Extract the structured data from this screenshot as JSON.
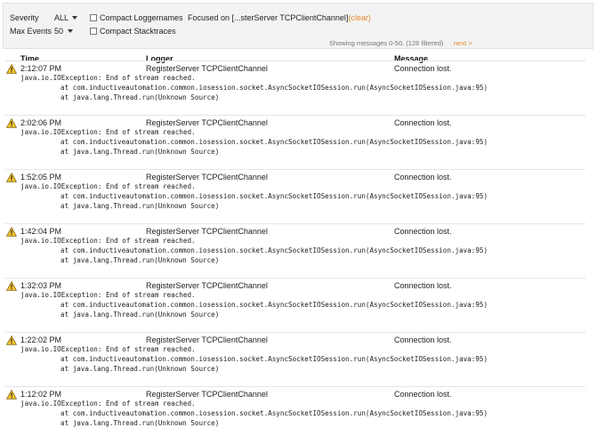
{
  "controls": {
    "severity_label": "Severity",
    "severity_value": "ALL",
    "max_events_label": "Max Events",
    "max_events_value": "50",
    "compact_loggernames_label": "Compact Loggernames",
    "compact_stacktraces_label": "Compact Stacktraces",
    "focused_text": "Focused on [...sterServer TCPClientChannel]",
    "clear_label": "(clear)",
    "showing_text": "Showing messages 0-50.  (126 filtered)",
    "next_label": "next >"
  },
  "columns": {
    "time": "Time",
    "logger": "Logger",
    "message": "Message"
  },
  "icons": {
    "row_icon": "warning-icon"
  },
  "colors": {
    "warning_fill": "#f2c230",
    "link": "#e08a2b"
  },
  "rows": [
    {
      "time": "2:12:07 PM",
      "logger": "RegisterServer TCPClientChannel",
      "message": "Connection lost.",
      "trace": [
        "java.io.IOException: End of stream reached.",
        "at com.inductiveautomation.common.iosession.socket.AsyncSocketIOSession.run(AsyncSocketIOSession.java:95)",
        "at java.lang.Thread.run(Unknown Source)"
      ]
    },
    {
      "time": "2:02:06 PM",
      "logger": "RegisterServer TCPClientChannel",
      "message": "Connection lost.",
      "trace": [
        "java.io.IOException: End of stream reached.",
        "at com.inductiveautomation.common.iosession.socket.AsyncSocketIOSession.run(AsyncSocketIOSession.java:95)",
        "at java.lang.Thread.run(Unknown Source)"
      ]
    },
    {
      "time": "1:52:05 PM",
      "logger": "RegisterServer TCPClientChannel",
      "message": "Connection lost.",
      "trace": [
        "java.io.IOException: End of stream reached.",
        "at com.inductiveautomation.common.iosession.socket.AsyncSocketIOSession.run(AsyncSocketIOSession.java:95)",
        "at java.lang.Thread.run(Unknown Source)"
      ]
    },
    {
      "time": "1:42:04 PM",
      "logger": "RegisterServer TCPClientChannel",
      "message": "Connection lost.",
      "trace": [
        "java.io.IOException: End of stream reached.",
        "at com.inductiveautomation.common.iosession.socket.AsyncSocketIOSession.run(AsyncSocketIOSession.java:95)",
        "at java.lang.Thread.run(Unknown Source)"
      ]
    },
    {
      "time": "1:32:03 PM",
      "logger": "RegisterServer TCPClientChannel",
      "message": "Connection lost.",
      "trace": [
        "java.io.IOException: End of stream reached.",
        "at com.inductiveautomation.common.iosession.socket.AsyncSocketIOSession.run(AsyncSocketIOSession.java:95)",
        "at java.lang.Thread.run(Unknown Source)"
      ]
    },
    {
      "time": "1:22:02 PM",
      "logger": "RegisterServer TCPClientChannel",
      "message": "Connection lost.",
      "trace": [
        "java.io.IOException: End of stream reached.",
        "at com.inductiveautomation.common.iosession.socket.AsyncSocketIOSession.run(AsyncSocketIOSession.java:95)",
        "at java.lang.Thread.run(Unknown Source)"
      ]
    },
    {
      "time": "1:12:02 PM",
      "logger": "RegisterServer TCPClientChannel",
      "message": "Connection lost.",
      "trace": [
        "java.io.IOException: End of stream reached.",
        "at com.inductiveautomation.common.iosession.socket.AsyncSocketIOSession.run(AsyncSocketIOSession.java:95)",
        "at java.lang.Thread.run(Unknown Source)"
      ]
    }
  ]
}
